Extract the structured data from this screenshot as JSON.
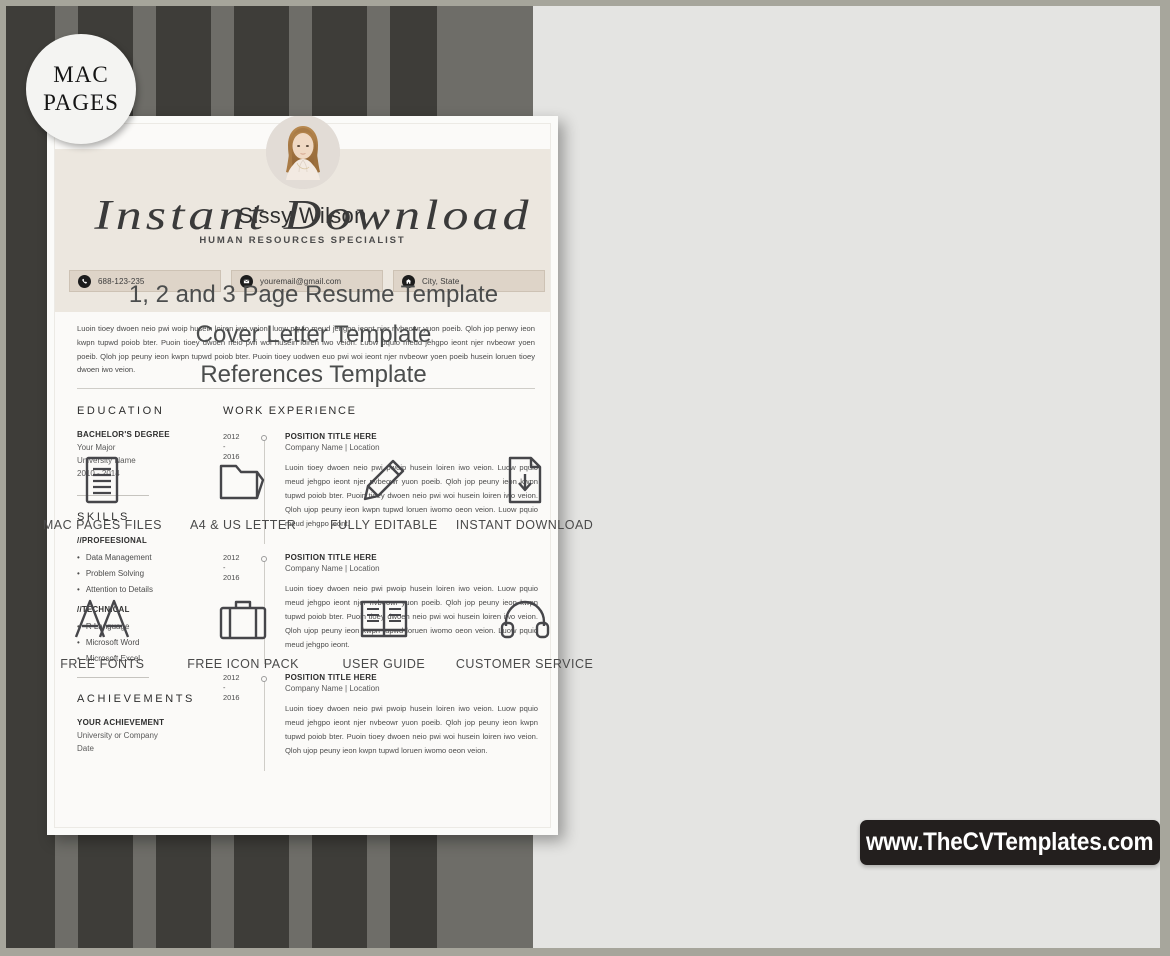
{
  "badge": {
    "line1": "MAC",
    "line2": "PAGES"
  },
  "resume": {
    "name": "Sissy Wilson",
    "role": "HUMAN RESOURCES SPECIALIST",
    "photo_alt": "profile-photo",
    "contacts": [
      {
        "icon": "phone-icon",
        "value": "688-123-235"
      },
      {
        "icon": "envelope-icon",
        "value": "youremail@gmail.com"
      },
      {
        "icon": "home-icon",
        "value": "City, State"
      }
    ],
    "summary": "Luoin tioey dwoen neio pwi woip husein loiren iwo veion. luow pquio meud jehgpo ieont njer nvbeowr yuon poeib. Qloh jop penwy ieon kwpn tupwd poiob bter. Puoin tioey dwoen neio pwi woi husein loiren iwo veion. Luow pquio meud jehgpo ieont njer nvbeowr yoen poeib. Qloh jop peuny ieon kwpn tupwd poiob bter. Puoin tioey uodwen euo pwi woi  ieont njer nvbeowr yoen poeib husein loruen tioey dwoen iwo veion.",
    "education": {
      "title": "EDUCATION",
      "degree": "BACHELOR'S DEGREE",
      "major": "Your Major",
      "school": "University Name",
      "dates": "2010 - 2014"
    },
    "skills": {
      "title": "SKILLS",
      "groups": [
        {
          "label": "//PROFEESIONAL",
          "items": [
            "Data Management",
            "Problem Solving",
            "Attention to Details"
          ]
        },
        {
          "label": "//TECHNICAL",
          "items": [
            "R Language",
            "Microsoft Word",
            "Microsoft Excel"
          ]
        }
      ]
    },
    "achievements": {
      "title": "ACHIEVEMENTS",
      "heading": "YOUR ACHIEVEMENT",
      "org": "University or Company",
      "date": "Date"
    },
    "work": {
      "title": "WORK EXPERIENCE",
      "entries": [
        {
          "year_from": "2012",
          "separator": "-",
          "year_to": "2016",
          "position": "POSITION TITLE HERE",
          "company": "Company Name | Location",
          "body": "Luoin tioey dwoen neio pwi pwoip husein loiren iwo veion. Luow pquio meud jehgpo ieont njer nvbeowr yuon poeib. Qloh jop peuny ieon kwpn tupwd poiob bter. Puoin tioey dwoen neio pwi woi husein loiren iwo veion. Qloh ujop peuny ieon kwpn tupwd loruen iwomo oeon veion. Luow pquio meud jehgpo ieont."
        },
        {
          "year_from": "2012",
          "separator": "-",
          "year_to": "2016",
          "position": "POSITION TITLE HERE",
          "company": "Company Name | Location",
          "body": "Luoin tioey dwoen neio pwi pwoip husein loiren iwo veion. Luow pquio meud jehgpo ieont njer nvbeowr yuon poeib. Qloh jop peuny ieon kwpn tupwd poiob bter. Puoin tioey dwoen neio pwi woi husein loiren iwo veion. Qloh ujop peuny ieon kwpn tupwd loruen iwomo oeon veion. Luow pquio meud jehgpo ieont."
        },
        {
          "year_from": "2012",
          "separator": "-",
          "year_to": "2016",
          "position": "POSITION TITLE HERE",
          "company": "Company Name | Location",
          "body": "Luoin tioey dwoen neio pwi pwoip husein loiren iwo veion. Luow pquio meud jehgpo ieont njer nvbeowr yuon poeib. Qloh jop peuny ieon kwpn tupwd poiob bter. Puoin tioey dwoen neio pwi woi husein loiren iwo veion. Qloh ujop peuny ieon kwpn tupwd loruen iwomo oeon veion."
        }
      ]
    }
  },
  "promo": {
    "headline": "Instant Download",
    "feature_lines": [
      "1, 2 and 3 Page Resume Template",
      "Cover Letter Template",
      "References Template"
    ],
    "features": [
      {
        "icon": "document-lines-icon",
        "label": "MAC PAGES FILES"
      },
      {
        "icon": "folder-icon",
        "label": "A4  & US LETTER"
      },
      {
        "icon": "pencil-icon",
        "label": "FULLY EDITABLE"
      },
      {
        "icon": "document-download-icon",
        "label": "INSTANT DOWNLOAD"
      },
      {
        "icon": "double-a-icon",
        "label": "FREE FONTS"
      },
      {
        "icon": "briefcase-icon",
        "label": "FREE ICON PACK"
      },
      {
        "icon": "open-book-icon",
        "label": "USER GUIDE"
      },
      {
        "icon": "headphones-icon",
        "label": "CUSTOMER SERVICE"
      }
    ],
    "url": "www.TheCVTemplates.com"
  },
  "colors": {
    "stripe_dark": "#3e3d39",
    "stripe_light": "#6e6d68",
    "panel_bg": "#e4e4e2",
    "resume_bg": "#fbfaf8",
    "header_beige": "#ece7df",
    "contact_bar": "#ded4c8",
    "banner_dark": "#231f1e"
  }
}
